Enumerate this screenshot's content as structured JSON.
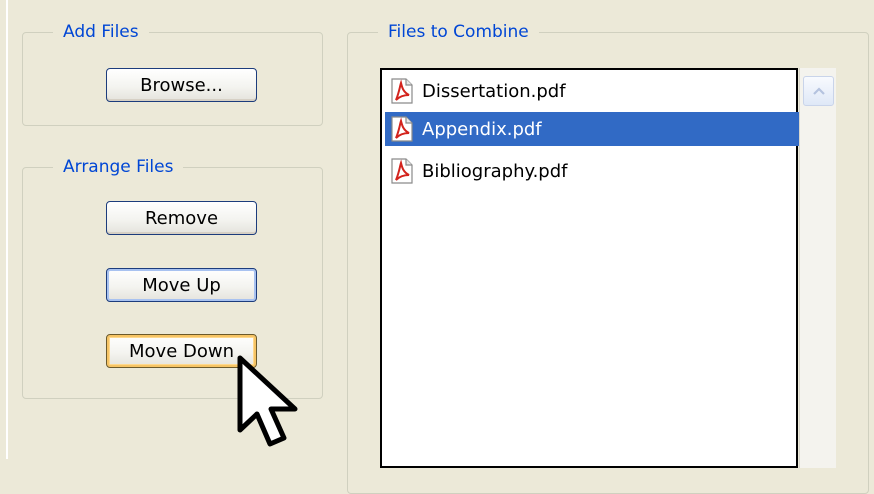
{
  "add_files": {
    "title": "Add Files",
    "browse_label": "Browse..."
  },
  "arrange_files": {
    "title": "Arrange Files",
    "remove_label": "Remove",
    "move_up_label": "Move Up",
    "move_down_label": "Move Down"
  },
  "files_to_combine": {
    "title": "Files to Combine",
    "files": [
      {
        "name": "Dissertation.pdf",
        "icon": "pdf-file-icon",
        "selected": false
      },
      {
        "name": "Appendix.pdf",
        "icon": "pdf-file-icon",
        "selected": true
      },
      {
        "name": "Bibliography.pdf",
        "icon": "pdf-file-icon",
        "selected": false
      }
    ]
  },
  "colors": {
    "group_title": "#0046d5",
    "selection": "#316ac5",
    "background": "#ece9d8"
  }
}
